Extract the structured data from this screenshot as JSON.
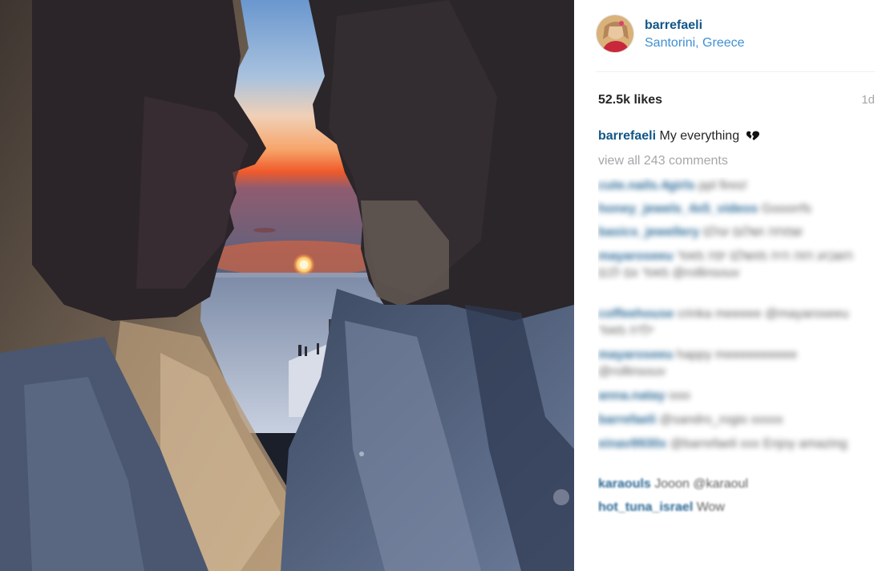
{
  "post": {
    "username": "barrefaeli",
    "location": "Santorini, Greece",
    "likes": "52.5k likes",
    "age": "1d",
    "caption_user": "barrefaeli",
    "caption_text": "My everything",
    "view_all": "view all 243 comments"
  },
  "comments": [
    {
      "user": "cute.nails.4girls",
      "text": "ppl fires!"
    },
    {
      "user": "honey_jewels_4x5_videos",
      "text": "Gooorrfs"
    },
    {
      "user": "basics_jewellery",
      "text": "שמחה ושלום עולם"
    },
    {
      "user": "mayaroseeu",
      "text": "השבוע הזה היה מושלם יפה מאוד מאוד גם לכם @rollinsouv"
    },
    {
      "user": "coffeehouse",
      "text": "crinka meeeee @mayaroseeu ילדה מאוד"
    },
    {
      "user": "mayaroseeu",
      "text": "happy meeeeeeeeee @rollinsouv"
    },
    {
      "user": "anna.natay",
      "text": "ooo"
    },
    {
      "user": "barrefaeli",
      "text": "@sandro_rogio xxxxx"
    },
    {
      "user": "einav9930x",
      "text": "@barrefaeli xxx Enjoy amazing"
    },
    {
      "user": "karaouls",
      "text": "Jooon @karaoul"
    },
    {
      "user": "hot_tuna_israel",
      "text": "Wow"
    }
  ],
  "colors": {
    "username": "#125688",
    "location": "#3f8fd3",
    "muted": "#a5a7aa",
    "text": "#262626"
  },
  "icons": {
    "caption_heart": "broken-black-heart-icon"
  }
}
